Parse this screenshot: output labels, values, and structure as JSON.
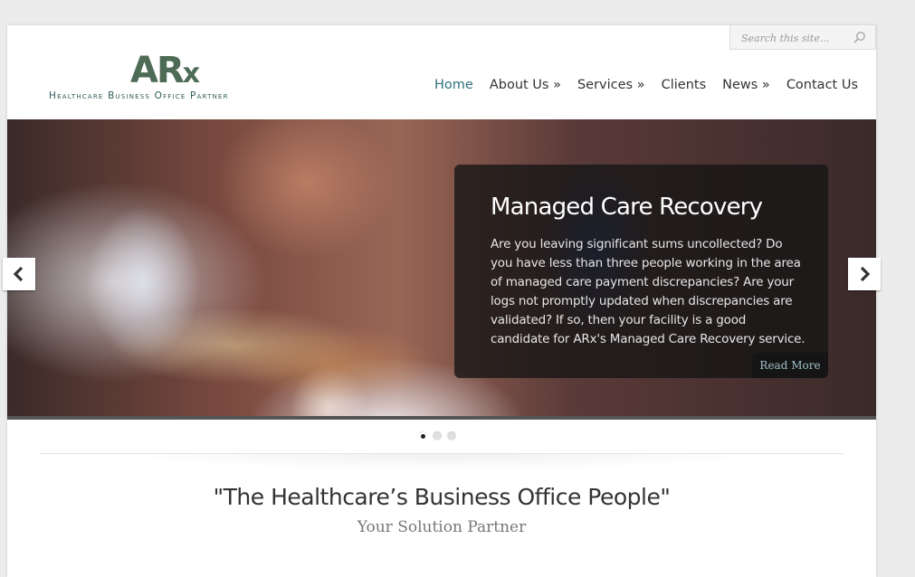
{
  "search": {
    "placeholder": "Search this site..."
  },
  "logo": {
    "mark": "ARx",
    "mark_main": "AR",
    "mark_x": "x",
    "tagline": "Healthcare Business Office Partner"
  },
  "nav": {
    "items": [
      {
        "label": "Home"
      },
      {
        "label": "About Us »"
      },
      {
        "label": "Services »"
      },
      {
        "label": "Clients"
      },
      {
        "label": "News »"
      },
      {
        "label": "Contact Us"
      }
    ],
    "active_index": 0
  },
  "slider": {
    "title": "Managed Care Recovery",
    "text": "Are you leaving significant sums uncollected? Do you have less than three people working in the area of managed care payment discrepancies? Are your logs not promptly updated when discrepancies are validated? If so, then your facility is a good candidate for ARx's Managed Care Recovery service.",
    "read_more": "Read More",
    "slide_count": 3,
    "active_slide": 1
  },
  "hero": {
    "tagline": "\"The Healthcare’s Business Office People\"",
    "subline": "Your Solution Partner"
  },
  "colors": {
    "brand_green": "#4d6b55",
    "nav_active": "#2e6f80",
    "read_more": "#9fc2c8"
  }
}
